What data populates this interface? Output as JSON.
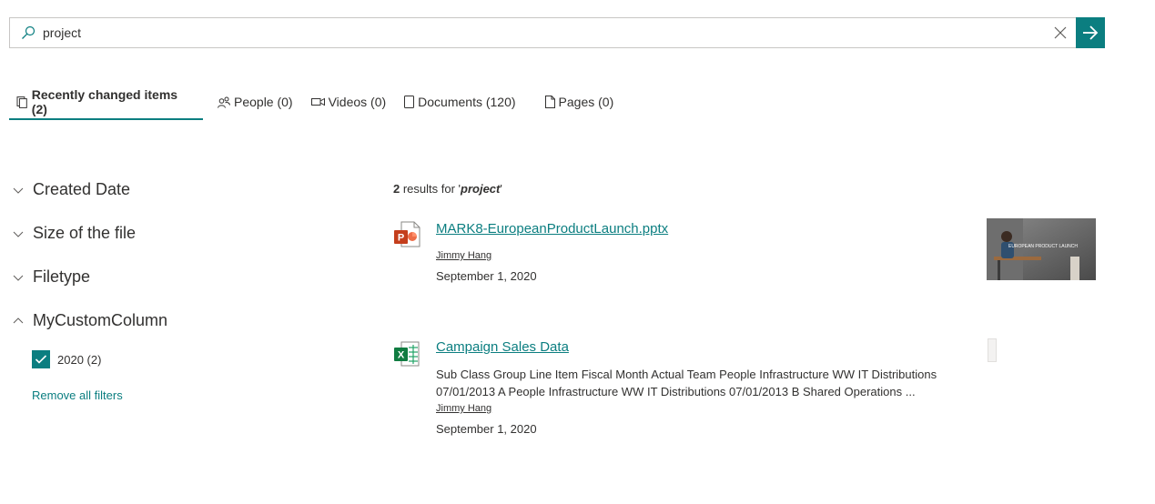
{
  "search": {
    "value": "project",
    "placeholder": ""
  },
  "tabs": [
    {
      "label": "Recently changed items (2)",
      "icon": "recent-items-icon"
    },
    {
      "label": "People (0)",
      "icon": "people-icon"
    },
    {
      "label": "Videos (0)",
      "icon": "video-icon"
    },
    {
      "label": "Documents (120)",
      "icon": "document-icon"
    },
    {
      "label": "Pages (0)",
      "icon": "page-icon"
    }
  ],
  "filters": {
    "groups": [
      {
        "label": "Created Date",
        "expanded": false
      },
      {
        "label": "Size of the file",
        "expanded": false
      },
      {
        "label": "Filetype",
        "expanded": false
      },
      {
        "label": "MyCustomColumn",
        "expanded": true
      }
    ],
    "options": [
      {
        "label": "2020 (2)",
        "checked": true
      }
    ],
    "remove_all": "Remove all filters"
  },
  "results": {
    "count": "2",
    "count_text": " results for '",
    "query": "project",
    "count_suffix": "'",
    "items": [
      {
        "title": "MARK8-EuropeanProductLaunch.pptx",
        "type_icon": "powerpoint-icon",
        "author": "Jimmy Hang",
        "date": "September 1, 2020",
        "thumbnail_text": "EUROPEAN PRODUCT LAUNCH"
      },
      {
        "title": "Campaign Sales Data",
        "type_icon": "excel-icon",
        "summary": "Sub Class Group Line Item Fiscal Month Actual Team People Infrastructure WW IT Distributions 07/01/2013 A People Infrastructure WW IT Distributions 07/01/2013 B Shared Operations ...",
        "author": "Jimmy Hang",
        "date": "September 1, 2020"
      }
    ]
  },
  "colors": {
    "accent": "#0b7e80",
    "text": "#323130",
    "border": "#c8c6c4"
  }
}
